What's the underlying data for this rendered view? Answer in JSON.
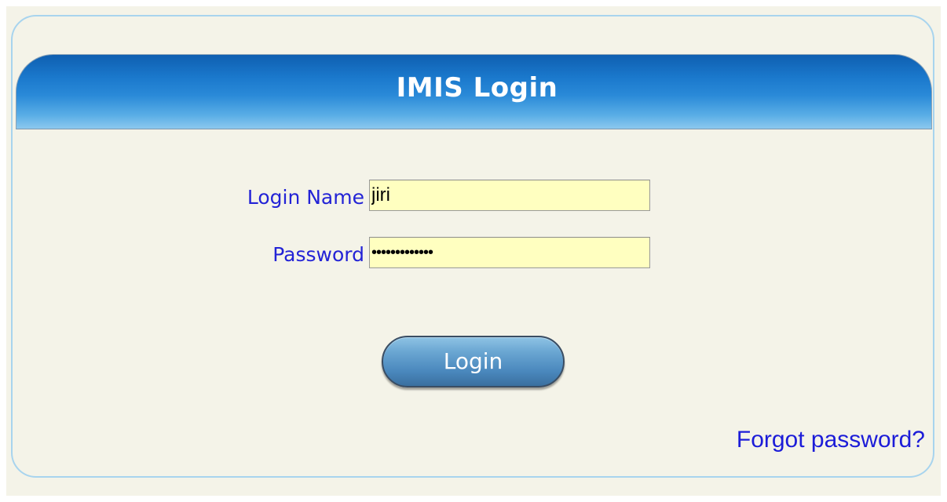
{
  "header": {
    "title": "IMIS Login"
  },
  "form": {
    "login_name_label": "Login Name",
    "login_name_value": "jiri",
    "password_label": "Password",
    "password_value": "•••••••••••••",
    "login_button_label": "Login",
    "forgot_password_label": "Forgot password?"
  },
  "colors": {
    "background": "#f4f3e8",
    "header_blue": "#1a78cc",
    "label_text": "#2323d6",
    "input_background": "#ffffc0",
    "link": "#1c1cd8"
  }
}
